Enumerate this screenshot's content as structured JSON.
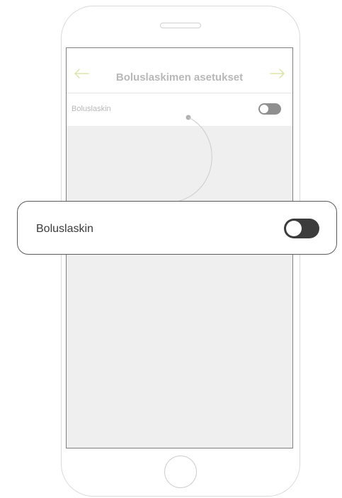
{
  "nav": {
    "title": "Boluslaskimen asetukset",
    "back_icon": "arrow-left-icon",
    "next_icon": "arrow-right-icon",
    "accent_color": "#d9e6a6"
  },
  "setting_row": {
    "label": "Boluslaskin",
    "enabled": false
  },
  "callout": {
    "label": "Boluslaskin",
    "enabled": false
  }
}
